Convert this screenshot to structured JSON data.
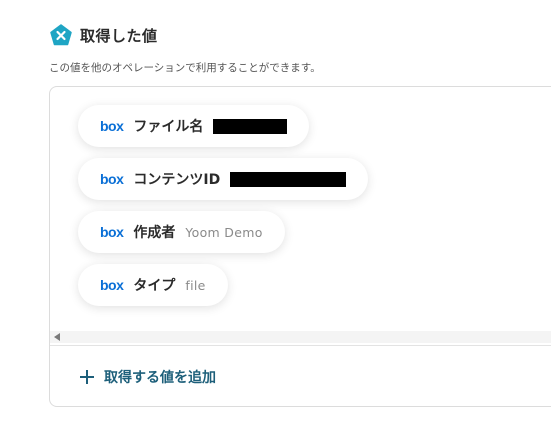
{
  "header": {
    "title": "取得した値",
    "icon": "yoom-pentagon-icon",
    "icon_color": "#1fa5c4"
  },
  "subtitle": "この値を他のオペレーションで利用することができます。",
  "fields": [
    {
      "logo": "box",
      "label": "ファイル名",
      "value": "",
      "redacted": true
    },
    {
      "logo": "box",
      "label": "コンテンツID",
      "value": "",
      "redacted": true
    },
    {
      "logo": "box",
      "label": "作成者",
      "value": "Yoom Demo",
      "redacted": false
    },
    {
      "logo": "box",
      "label": "タイプ",
      "value": "file",
      "redacted": false
    }
  ],
  "add_button": {
    "label": "取得する値を追加",
    "color": "#1d5f7a"
  },
  "colors": {
    "box_brand": "#0a6fd6"
  }
}
